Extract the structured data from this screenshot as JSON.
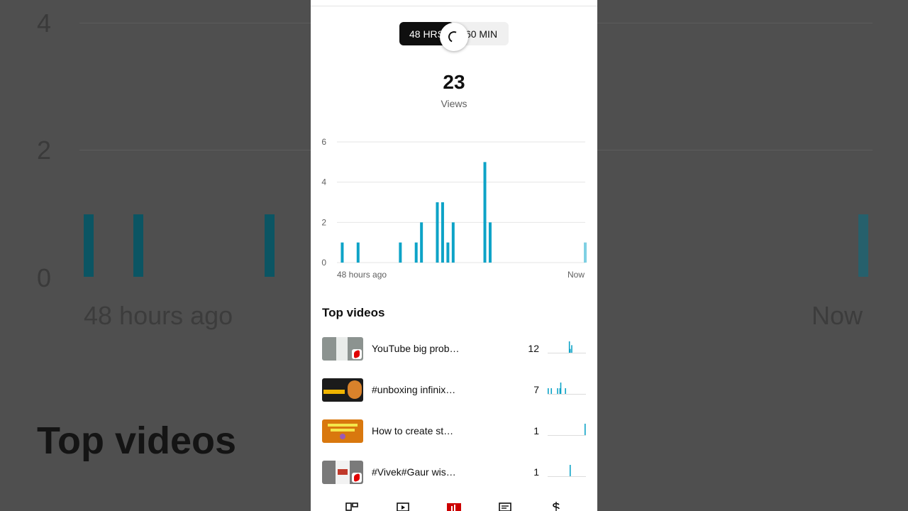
{
  "toggle": {
    "option_48": "48 HRS",
    "option_60": "60 MIN",
    "selected": "48 HRS"
  },
  "metric": {
    "value": "23",
    "label": "Views"
  },
  "chart_data": {
    "type": "bar",
    "y_ticks": [
      "6",
      "4",
      "2",
      "0"
    ],
    "ylim": [
      0,
      6
    ],
    "x_start_label": "48 hours ago",
    "x_end_label": "Now",
    "bar_count": 48,
    "values": [
      0,
      1,
      0,
      0,
      1,
      0,
      0,
      0,
      0,
      0,
      0,
      0,
      1,
      0,
      0,
      1,
      2,
      0,
      0,
      3,
      3,
      1,
      2,
      0,
      0,
      0,
      0,
      0,
      5,
      2,
      0,
      0,
      0,
      0,
      0,
      0,
      0,
      0,
      0,
      0,
      0,
      0,
      0,
      0,
      0,
      0,
      0,
      1
    ],
    "colors": {
      "bar": "#0da3c7",
      "last_bar": "#7fd0e3",
      "grid": "#e6e6e6"
    }
  },
  "top_videos": {
    "title": "Top videos",
    "items": [
      {
        "title": "YouTube big prob…",
        "views": "12",
        "spark": [
          0,
          0,
          0,
          0,
          0,
          0,
          0,
          0,
          0,
          0,
          0,
          0,
          0,
          0,
          0,
          0,
          0,
          0,
          0,
          0,
          0,
          0,
          0,
          0,
          0,
          0,
          0,
          3,
          1,
          0,
          2,
          0,
          0,
          0,
          0,
          0,
          0,
          0,
          0,
          0,
          0,
          0,
          0,
          0,
          0,
          0,
          0,
          0
        ]
      },
      {
        "title": "#unboxing infinix…",
        "views": "7",
        "spark": [
          1,
          0,
          0,
          0,
          1,
          0,
          0,
          0,
          0,
          0,
          0,
          0,
          1,
          0,
          0,
          1,
          2,
          0,
          0,
          0,
          0,
          0,
          1,
          0,
          0,
          0,
          0,
          0,
          0,
          0,
          0,
          0,
          0,
          0,
          0,
          0,
          0,
          0,
          0,
          0,
          0,
          0,
          0,
          0,
          0,
          0,
          0,
          0
        ]
      },
      {
        "title": "How to create st…",
        "views": "1",
        "spark": [
          0,
          0,
          0,
          0,
          0,
          0,
          0,
          0,
          0,
          0,
          0,
          0,
          0,
          0,
          0,
          0,
          0,
          0,
          0,
          0,
          0,
          0,
          0,
          0,
          0,
          0,
          0,
          0,
          0,
          0,
          0,
          0,
          0,
          0,
          0,
          0,
          0,
          0,
          0,
          0,
          0,
          0,
          0,
          0,
          0,
          0,
          0,
          1
        ]
      },
      {
        "title": "#Vivek#Gaur wis…",
        "views": "1",
        "spark": [
          0,
          0,
          0,
          0,
          0,
          0,
          0,
          0,
          0,
          0,
          0,
          0,
          0,
          0,
          0,
          0,
          0,
          0,
          0,
          0,
          0,
          0,
          0,
          0,
          0,
          0,
          0,
          0,
          1,
          0,
          0,
          0,
          0,
          0,
          0,
          0,
          0,
          0,
          0,
          0,
          0,
          0,
          0,
          0,
          0,
          0,
          0,
          0
        ]
      }
    ]
  },
  "bottom_nav": [
    {
      "icon": "dashboard-icon",
      "active": false
    },
    {
      "icon": "content-icon",
      "active": false
    },
    {
      "icon": "analytics-icon",
      "active": true
    },
    {
      "icon": "comments-icon",
      "active": false
    },
    {
      "icon": "earn-icon",
      "active": false
    }
  ]
}
